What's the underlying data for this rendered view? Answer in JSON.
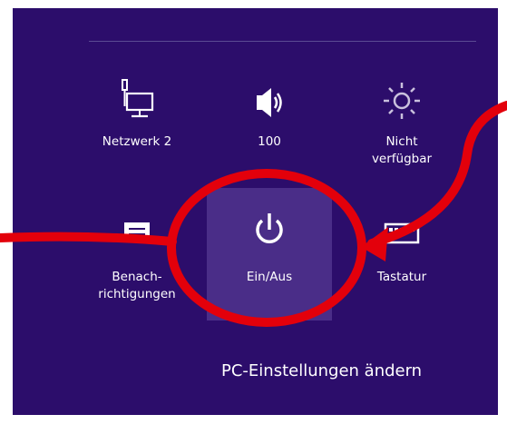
{
  "tiles": {
    "network": {
      "label": "Netzwerk  2",
      "icon": "network-icon"
    },
    "volume": {
      "label": "100",
      "icon": "speaker-icon"
    },
    "brightness": {
      "label": "Nicht\nverfügbar",
      "icon": "brightness-icon"
    },
    "notifications": {
      "label": "Benach-\nrichtigungen",
      "icon": "notification-icon"
    },
    "power": {
      "label": "Ein/Aus",
      "icon": "power-icon"
    },
    "keyboard": {
      "label": "Tastatur",
      "icon": "keyboard-icon"
    }
  },
  "settings_link": "PC-Einstellungen ändern",
  "colors": {
    "panel": "#2c0d6b",
    "active_tile": "#4a2d88",
    "annotation": "#e3000b"
  }
}
